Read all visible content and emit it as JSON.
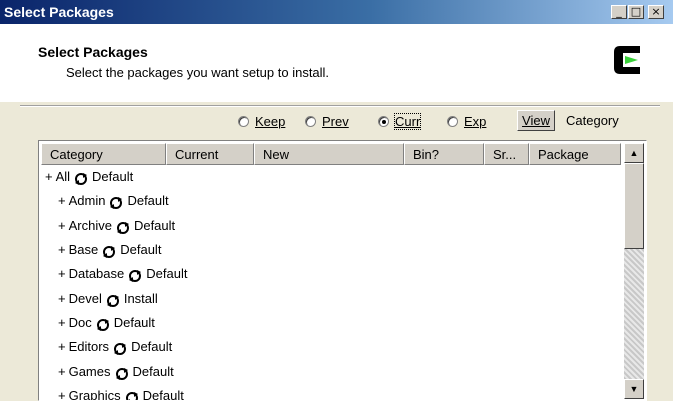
{
  "window": {
    "title": "Select Packages",
    "controls": {
      "minimize": "_",
      "maximize": "□",
      "close": "×"
    }
  },
  "header": {
    "title": "Select Packages",
    "subtitle": "Select the packages you want setup to install.",
    "logo_icon": "cygwin-logo-icon"
  },
  "view_options": {
    "radios": [
      {
        "label": "Keep",
        "checked": false
      },
      {
        "label": "Prev",
        "checked": false
      },
      {
        "label": "Curr",
        "checked": true
      },
      {
        "label": "Exp",
        "checked": false
      }
    ],
    "view_button": "View",
    "view_mode": "Category"
  },
  "list": {
    "columns": [
      "Category",
      "Current",
      "New",
      "Bin?",
      "Sr...",
      "Package"
    ],
    "rows": [
      {
        "prefix": "+",
        "name": "All",
        "action": "Default"
      },
      {
        "prefix": "+",
        "name": "Admin",
        "action": "Default"
      },
      {
        "prefix": "+",
        "name": "Archive",
        "action": "Default"
      },
      {
        "prefix": "+",
        "name": "Base",
        "action": "Default"
      },
      {
        "prefix": "+",
        "name": "Database",
        "action": "Default"
      },
      {
        "prefix": "+",
        "name": "Devel",
        "action": "Install"
      },
      {
        "prefix": "+",
        "name": "Doc",
        "action": "Default"
      },
      {
        "prefix": "+",
        "name": "Editors",
        "action": "Default"
      },
      {
        "prefix": "+",
        "name": "Games",
        "action": "Default"
      },
      {
        "prefix": "+",
        "name": "Graphics",
        "action": "Default"
      }
    ],
    "scroll_up": "▲",
    "scroll_down": "▼"
  }
}
